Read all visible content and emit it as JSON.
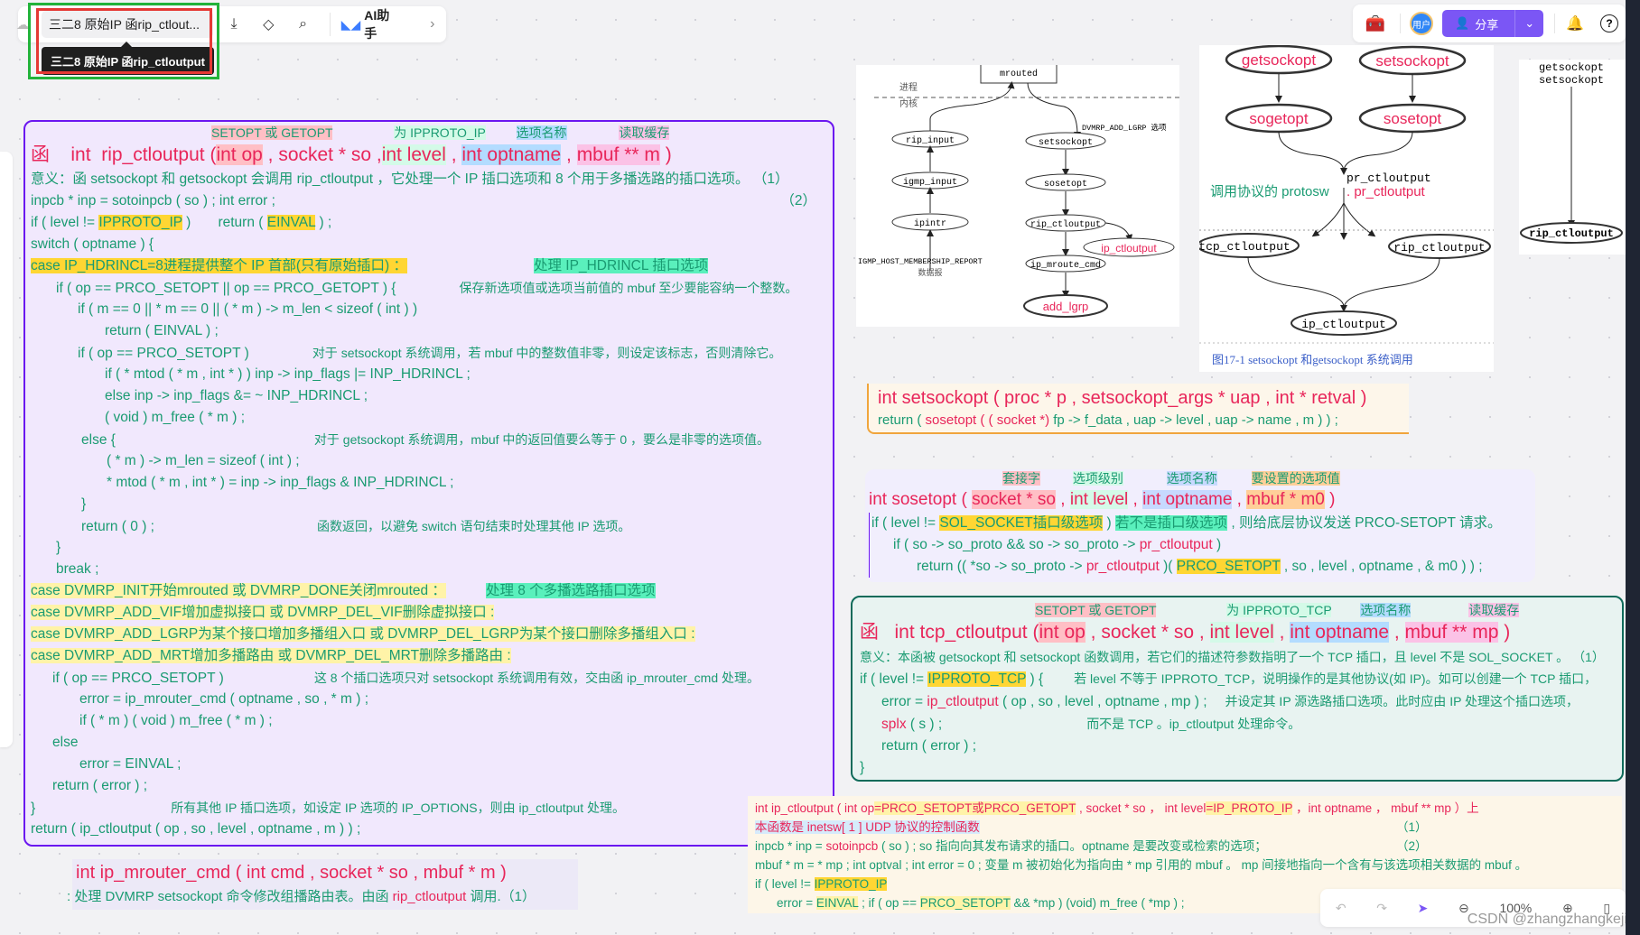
{
  "toolbar": {
    "doc_title": "三二8 原始IP 函rip_ctlout...",
    "tooltip": "三二8 原始IP 函rip_ctloutput",
    "ai_label": "AI助手",
    "share_label": "分享",
    "avatar_label": "用户"
  },
  "zoom": {
    "level": "100%"
  },
  "watermark": "CSDN @zhangzhangkeji",
  "rip_card": {
    "labels": [
      "SETOPT 或 GETOPT",
      "为 IPPROTO_IP",
      "选项名称",
      "读取缓存"
    ],
    "sig": {
      "prefix": "函",
      "ret": "int",
      "name": "rip_ctloutput (",
      "p1": "int op",
      ",1": " , socket * so ,",
      "p2": "int level",
      "c2": " , ",
      "p3": "int optname",
      "c3": " , ",
      "p4": "mbuf ** m",
      "end": " )"
    },
    "lines": [
      "意义：函 setsockopt 和 getsockopt 会调用 rip_ctloutput ，它处理一个 IP 插口选项和 8 个用于多播选路的插口选项。 （1）",
      "inpcb * inp = sotoinpcb ( so ) ;        int  error ;",
      "if ( level  !=  IPPROTO_IP )        return ( EINVAL ) ;",
      "switch ( optname ) {",
      "case  IP_HDRINCL=8进程提供整个 IP 首部(只有原始插口) ：",
      "if ( op == PRCO_SETOPT || op == PRCO_GETOPT ) {",
      "if ( m == 0 || * m == 0  ||  ( * m ) -> m_len < sizeof ( int ) )",
      "return ( EINVAL ) ;",
      "if ( op == PRCO_SETOPT )",
      "if ( * mtod ( * m , int * ) )      inp -> inp_flags   |=    INP_HDRINCL ;",
      "else                               inp -> inp_flags  &= ~ INP_HDRINCL ;",
      "( void ) m_free ( * m ) ;",
      "else {",
      "( * m ) -> m_len = sizeof ( int ) ;",
      "* mtod ( * m , int * ) = inp -> inp_flags & INP_HDRINCL ;",
      "}",
      "return ( 0 ) ;",
      "}",
      "break ;",
      "case  DVMRP_INIT开始mrouted      或  DVMRP_DONE关闭mrouted ：",
      "case  DVMRP_ADD_VIF增加虚拟接口   或  DVMRP_DEL_VIF删除虚拟接口 :",
      "case  DVMRP_ADD_LGRP为某个接口增加多播组入口 或  DVMRP_DEL_LGRP为某个接口删除多播组入口 :",
      "case  DVMRP_ADD_MRT增加多播路由  或  DVMRP_DEL_MRT删除多播路由 :",
      "if ( op == PRCO_SETOPT )",
      "error = ip_mrouter_cmd ( optname , so , * m ) ;",
      "if ( * m )       ( void ) m_free ( * m ) ;",
      "else",
      "error = EINVAL ;",
      "return  ( error ) ;",
      "}",
      "return    ( ip_ctloutput ( op , so , level , optname , m ) ) ;"
    ],
    "notes": {
      "n2": "（2）",
      "hdrincl": "处理 IP_HDRINCL 插口选项",
      "mbuf": "保存新选项值或选项当前值的 mbuf 至少要能容纳一个整数。",
      "setopt": "对于 setsockopt 系统调用，若 mbuf 中的整数值非零，则设定该标志，否则清除它。",
      "getopt": "对于 getsockopt 系统调用，mbuf 中的返回值要么等于 0 ，要么是非零的选项值。",
      "ret0": "函数返回，以避免 switch 语句结束时处理其他 IP 选项。",
      "multi": "处理 8 个多播选路插口选项",
      "only": "这 8 个插口选项只对 setsockopt 系统调用有效，交由函 ip_mrouter_cmd 处理。",
      "others": "所有其他 IP 插口选项，如设定 IP 选项的 IP_OPTIONS，则由 ip_ctloutput 处理。"
    }
  },
  "mroute": {
    "sig": "int   ip_mrouter_cmd ( int  cmd , socket * so ,  mbuf  * m )",
    "desc_a": ": 处理 DVMRP setsockopt 命令修改组播路由表。由函 ",
    "desc_fn": "rip_ctloutput",
    "desc_b": " 调用.（1）"
  },
  "fig_left": {
    "nodes": [
      "mrouted",
      "rip_input",
      "igmp_input",
      "ipintr",
      "setsockopt",
      "sosetopt",
      "rip_ctloutput",
      "ip_ctloutput",
      "ip_mroute_cmd",
      "add_lgrp"
    ],
    "labels": {
      "proc": "进程",
      "kernel": "内核",
      "opt": "DVMRP_ADD_LGRP 选项",
      "report": "IGMP_HOST_MEMBERSHIP_REPORT",
      "datagram": "数据报"
    }
  },
  "fig_right": {
    "nodes": [
      "getsockopt",
      "setsockopt",
      "sogetopt",
      "sosetopt",
      "pr_ctloutput",
      "tcp_ctloutput",
      "rip_ctloutput",
      "ip_ctloutput"
    ],
    "note_a": "调用协议的 protosw",
    "note_b": ". pr_ctloutput",
    "caption": "图17-1   setsockopt  和getsockopt   系统调用"
  },
  "fig_small": {
    "lines": [
      "getsockopt",
      "setsockopt"
    ],
    "node": "rip_ctloutput"
  },
  "setsockopt_card": {
    "sig": "int   setsockopt ( proc * p , setsockopt_args * uap ,  int * retval  )",
    "ret_a": "return   ( ",
    "ret_b": "sosetopt ( ( socket *) ",
    "ret_c": "fp -> f_data , uap -> level ,  uap -> name , m ) ) ;"
  },
  "sosetopt_card": {
    "labels": [
      "套接字",
      "选项级别",
      "选项名称",
      "要设置的选项值"
    ],
    "sig": {
      "ret": "int   sosetopt (",
      "p1": "socket * so",
      "p2": "int  level",
      "p3": "int  optname",
      "p4": "mbuf  * m0",
      "end": " )"
    },
    "l1a": "if ( level  !=  ",
    "l1b": "SOL_SOCKET插口级选项",
    "l1c": " )       ",
    "l1d": "若不是插口级选项",
    "l1e": " , 则给底层协议发送 PRCO-SETOPT 请求。",
    "l2a": "if ( so -> so_proto &&  so -> so_proto -> ",
    "l2b": "pr_ctloutput",
    "l2c": " )",
    "l3a": "return  (( *so -> so_proto -> ",
    "l3b": "pr_ctloutput",
    "l3c": " )( ",
    "l3d": "PRCO_SETOPT",
    "l3e": " , so , level , optname , & m0 ) ) ;"
  },
  "tcp_card": {
    "labels": [
      "SETOPT 或 GETOPT",
      "为 IPPROTO_TCP",
      "选项名称",
      "读取缓存"
    ],
    "sig": {
      "prefix": "函",
      "name": "int   tcp_ctloutput (",
      "p1": "int  op",
      "c1": " , socket * so , ",
      "p2": "int  level",
      "c2": " , ",
      "p3": "int  optname",
      "c3": " , ",
      "p4": "mbuf ** mp",
      "end": " )"
    },
    "desc": "意义：本函被 getsockopt 和 setsockopt 函数调用，若它们的描述符参数指明了一个 TCP 插口，且 level 不是 SOL_SOCKET 。 （1）",
    "l1a": "if ( level  !=  ",
    "l1b": "IPPROTO_TCP",
    "l1c": " ) {",
    "n1": "若 level 不等于 IPPROTO_TCP，说明操作的是其他协议(如 IP)。如可以创建一个 TCP 插口，",
    "l2a": "error = ",
    "l2b": "ip_ctloutput",
    "l2c": " ( op , so , level , optname , mp ) ;",
    "n2": "并设定其 IP 源选路插口选项。此时应由 IP 处理这个插口选项，",
    "l3a": "splx",
    "l3b": " ( s ) ;",
    "n3": "而不是 TCP 。ip_ctloutput 处理命令。",
    "l4": "return  ( error ) ;",
    "l5": "}"
  },
  "ipc_card": {
    "l1": [
      "int   ip_ctloutput ( int  op",
      "=PRCO_SETOPT或PRCO_GETOPT",
      " , socket * so ， int  level",
      "=IP_PROTO_IP",
      " ，int  optname ， mbuf ** mp ）上"
    ],
    "l2": "本函数是 inetsw[ 1 ] UDP 协议的控制函数",
    "l3a": "inpcb * inp  =  ",
    "l3b": "sotoinpcb",
    "l3c": " ( so ) ;     so 指向向其发布请求的插口。optname 是要改变或检索的选项；",
    "l4": "mbuf * m = * mp ; int  optval ;   int  error = 0 ;    变量 m 被初始化为指向由 * mp 引用的 mbuf 。  mp 间接地指向一个含有与该选项相关数据的 mbuf 。",
    "l5a": "if ( level  != ",
    "l5b": "IPPROTO_IP",
    "l6a": "error = ",
    "l6b": "EINVAL",
    "l6c": " ;       if ( op == ",
    "l6d": "PRCO_SETOPT",
    "l6e": "  && *mp )     (void) m_free ( *mp ) ;",
    "n1": "（1）",
    "n2": "（2）"
  }
}
